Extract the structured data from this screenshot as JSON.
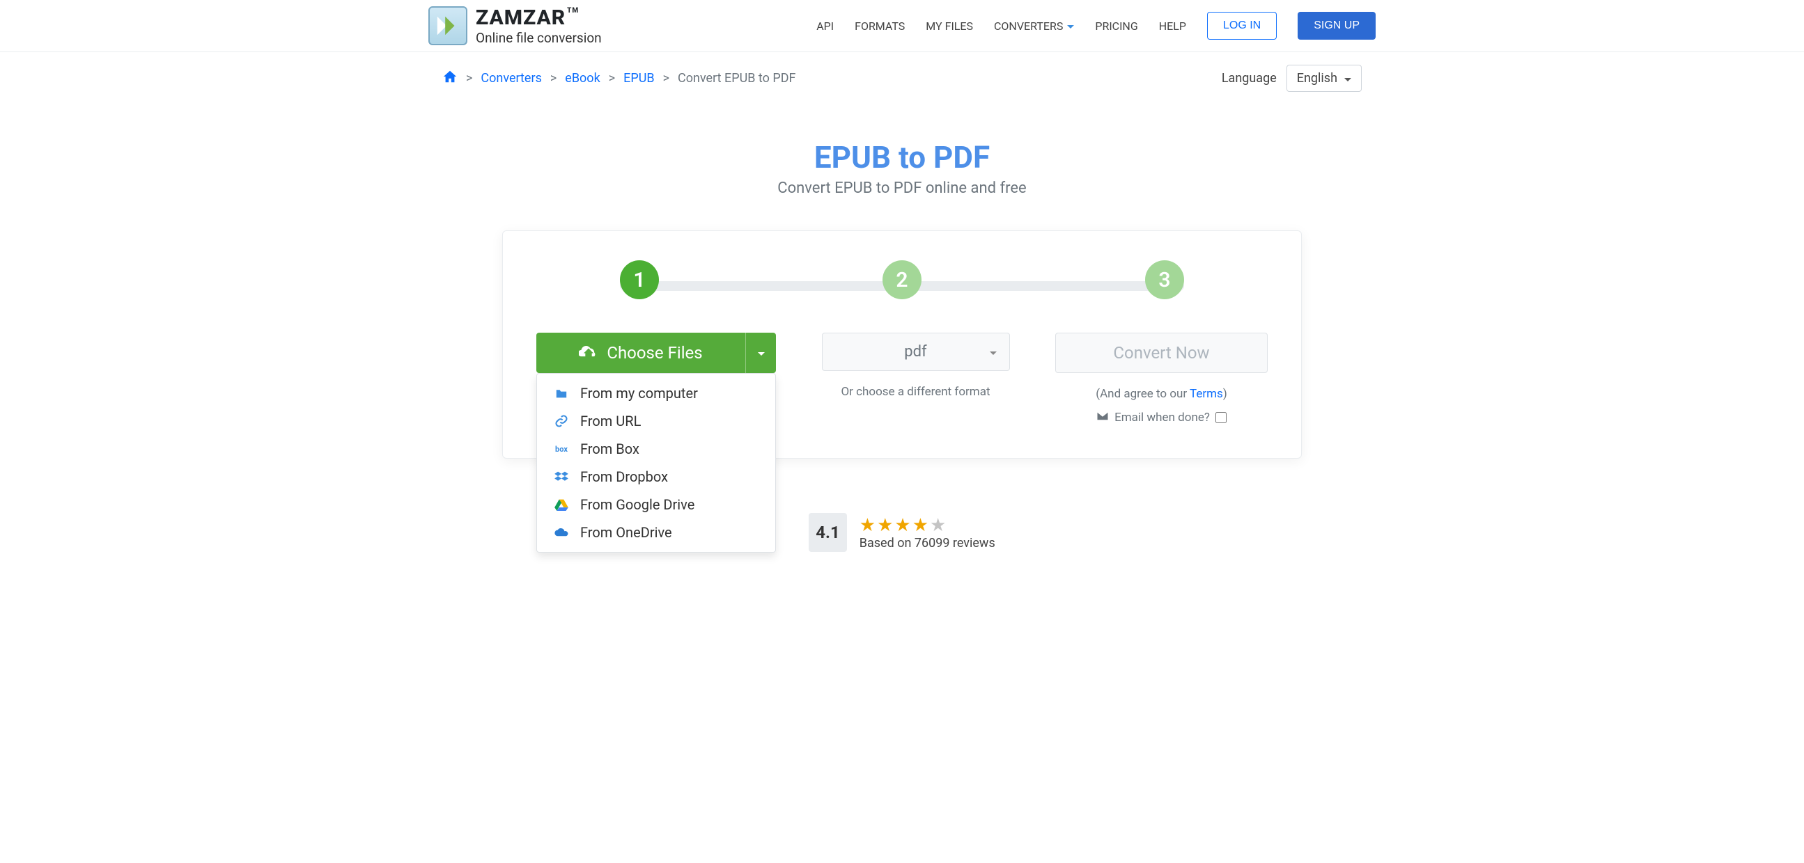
{
  "logo": {
    "title": "ZAMZAR",
    "tm": "TM",
    "sub": "Online file conversion"
  },
  "nav": {
    "api": "API",
    "formats": "FORMATS",
    "myfiles": "MY FILES",
    "converters": "CONVERTERS",
    "pricing": "PRICING",
    "help": "HELP",
    "login": "LOG IN",
    "signup": "SIGN UP"
  },
  "breadcrumb": {
    "sep": ">",
    "converters": "Converters",
    "ebook": "eBook",
    "epub": "EPUB",
    "current": "Convert EPUB to PDF"
  },
  "language": {
    "label": "Language",
    "value": "English"
  },
  "hero": {
    "title": "EPUB to PDF",
    "subtitle": "Convert EPUB to PDF online and free"
  },
  "steps": {
    "s1": "1",
    "s2": "2",
    "s3": "3"
  },
  "choose": {
    "label": "Choose Files"
  },
  "dropdown": {
    "computer": "From my computer",
    "url": "From URL",
    "box": "From Box",
    "dropbox": "From Dropbox",
    "gdrive": "From Google Drive",
    "onedrive": "From OneDrive"
  },
  "format": {
    "value": "pdf",
    "hint": "Or choose a different format"
  },
  "convert": {
    "label": "Convert Now",
    "agree_pre": "(And agree to our ",
    "agree_link": "Terms",
    "agree_post": ")",
    "email": "Email when done?"
  },
  "rating": {
    "score": "4.1",
    "text": "Based on 76099 reviews"
  }
}
